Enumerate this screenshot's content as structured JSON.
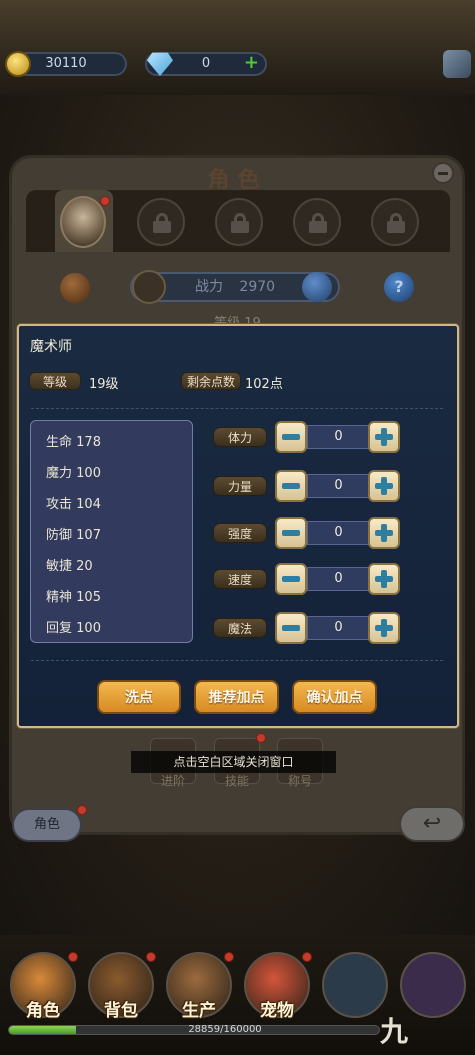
{
  "currency": {
    "gold": "30110",
    "gems": "0",
    "gem_add": "+"
  },
  "panel": {
    "title": "角色",
    "power_label": "战力",
    "power_value": "2970",
    "level_peek": "等级 19",
    "help": "?"
  },
  "modal": {
    "class_name": "魔术师",
    "level_label": "等级",
    "level_value": "19级",
    "points_label": "剩余点数",
    "points_value": "102点",
    "stats": [
      {
        "label": "生命",
        "value": "178"
      },
      {
        "label": "魔力",
        "value": "100"
      },
      {
        "label": "攻击",
        "value": "104"
      },
      {
        "label": "防御",
        "value": "107"
      },
      {
        "label": "敏捷",
        "value": "20"
      },
      {
        "label": "精神",
        "value": "105"
      },
      {
        "label": "回复",
        "value": "100"
      }
    ],
    "attributes": [
      {
        "label": "体力",
        "value": "0"
      },
      {
        "label": "力量",
        "value": "0"
      },
      {
        "label": "强度",
        "value": "0"
      },
      {
        "label": "速度",
        "value": "0"
      },
      {
        "label": "魔法",
        "value": "0"
      }
    ],
    "buttons": {
      "reset": "洗点",
      "recommend": "推荐加点",
      "confirm": "确认加点"
    }
  },
  "hint": "点击空白区域关闭窗口",
  "below_tabs": [
    "进阶",
    "技能",
    "称号"
  ],
  "role_pill": "角色",
  "back_icon": "↩",
  "bottom_nav": [
    {
      "label": "角色",
      "icon": "character-icon",
      "color": "#d98a3a"
    },
    {
      "label": "背包",
      "icon": "backpack-icon",
      "color": "#8a5a2e"
    },
    {
      "label": "生产",
      "icon": "hammer-icon",
      "color": "#9c6b3e"
    },
    {
      "label": "宠物",
      "icon": "pet-icon",
      "color": "#d4553a"
    }
  ],
  "xp": {
    "text": "28859/160000",
    "fraction": 0.18
  },
  "watermark": "九"
}
